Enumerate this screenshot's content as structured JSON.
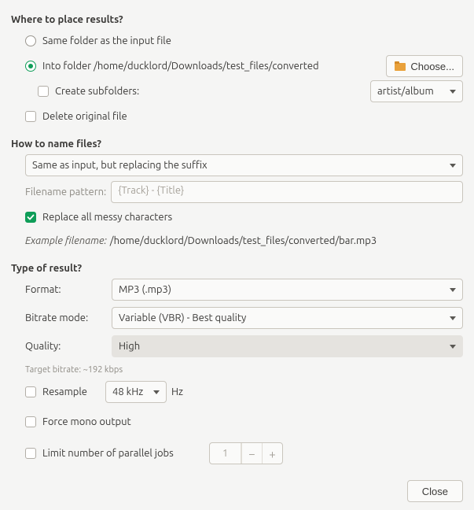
{
  "placement": {
    "title": "Where to place results?",
    "same_folder_label": "Same folder as the input file",
    "into_folder_label": "Into folder /home/ducklord/Downloads/test_files/converted",
    "choose_button": "Choose...",
    "create_subfolders_label": "Create subfolders:",
    "subfolder_pattern": "artist/album",
    "delete_original_label": "Delete original file"
  },
  "naming": {
    "title": "How to name files?",
    "mode": "Same as input, but replacing the suffix",
    "pattern_label": "Filename pattern:",
    "pattern_placeholder": "{Track} - {Title}",
    "replace_messy_label": "Replace all messy characters",
    "example_label": "Example filename:",
    "example_value": "/home/ducklord/Downloads/test_files/converted/bar.mp3"
  },
  "result": {
    "title": "Type of result?",
    "format_label": "Format:",
    "format_value": "MP3 (.mp3)",
    "bitrate_mode_label": "Bitrate mode:",
    "bitrate_mode_value": "Variable (VBR) - Best quality",
    "quality_label": "Quality:",
    "quality_value": "High",
    "target_bitrate": "Target bitrate: ~192 kbps",
    "resample_label": "Resample",
    "resample_value": "48 kHz",
    "resample_unit": "Hz",
    "force_mono_label": "Force mono output",
    "limit_jobs_label": "Limit number of parallel jobs",
    "jobs_value": "1"
  },
  "footer": {
    "close": "Close"
  }
}
